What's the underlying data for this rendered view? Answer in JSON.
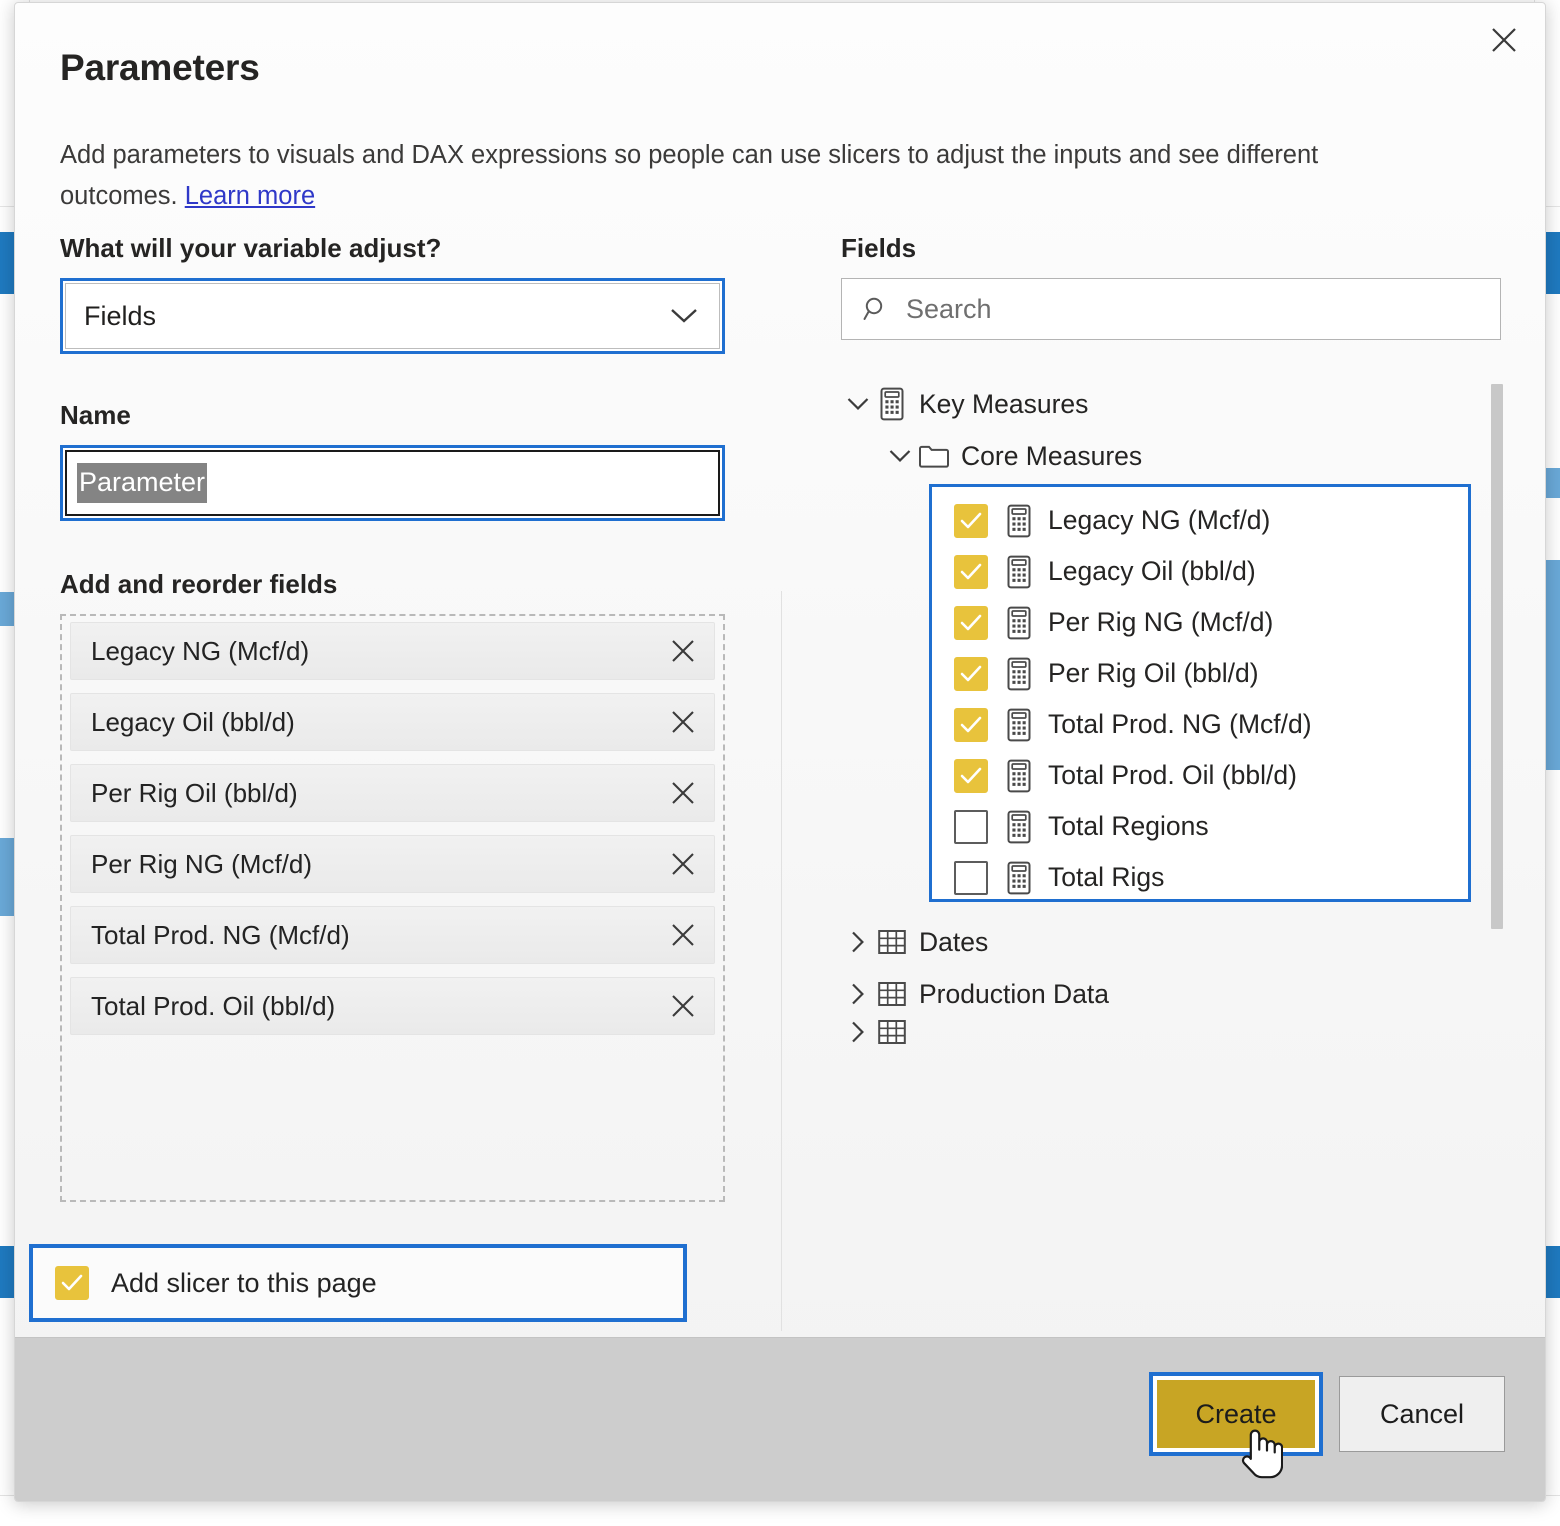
{
  "dialog": {
    "title": "Parameters",
    "description_part1": "Add parameters to visuals and DAX expressions so people can use slicers to adjust the inputs and see different outcomes. ",
    "learn_more": "Learn more",
    "close_icon": "close-icon"
  },
  "variable_type": {
    "label": "What will your variable adjust?",
    "selected": "Fields",
    "chevron_icon": "chevron-down-icon"
  },
  "name": {
    "label": "Name",
    "value": "Parameter",
    "selected": true
  },
  "reorder": {
    "label": "Add and reorder fields",
    "remove_icon": "close-icon",
    "items": [
      {
        "label": "Legacy NG (Mcf/d)"
      },
      {
        "label": "Legacy Oil (bbl/d)"
      },
      {
        "label": "Per Rig Oil (bbl/d)"
      },
      {
        "label": "Per Rig NG (Mcf/d)"
      },
      {
        "label": "Total Prod. NG (Mcf/d)"
      },
      {
        "label": "Total Prod. Oil (bbl/d)"
      }
    ]
  },
  "slicer": {
    "label": "Add slicer to this page",
    "checked": true
  },
  "fields_panel": {
    "label": "Fields",
    "search": {
      "placeholder": "Search",
      "value": "",
      "icon": "search-icon"
    },
    "tree": [
      {
        "label": "Key Measures",
        "icon": "measure-table-icon",
        "expanded": true,
        "indent": 0
      },
      {
        "label": "Core Measures",
        "icon": "folder-icon",
        "expanded": true,
        "indent": 1
      }
    ],
    "measures": [
      {
        "label": "Legacy NG (Mcf/d)",
        "checked": true,
        "icon": "calculator-icon"
      },
      {
        "label": "Legacy Oil (bbl/d)",
        "checked": true,
        "icon": "calculator-icon"
      },
      {
        "label": "Per Rig NG (Mcf/d)",
        "checked": true,
        "icon": "calculator-icon"
      },
      {
        "label": "Per Rig Oil (bbl/d)",
        "checked": true,
        "icon": "calculator-icon"
      },
      {
        "label": "Total Prod. NG (Mcf/d)",
        "checked": true,
        "icon": "calculator-icon"
      },
      {
        "label": "Total Prod. Oil (bbl/d)",
        "checked": true,
        "icon": "calculator-icon"
      },
      {
        "label": "Total Regions",
        "checked": false,
        "icon": "calculator-icon"
      },
      {
        "label": "Total Rigs",
        "checked": false,
        "icon": "calculator-icon"
      }
    ],
    "tables": [
      {
        "label": "Dates",
        "icon": "table-icon",
        "expanded": false
      },
      {
        "label": "Production Data",
        "icon": "table-icon",
        "expanded": false
      }
    ]
  },
  "footer": {
    "create_label": "Create",
    "cancel_label": "Cancel"
  },
  "colors": {
    "accent_focus": "#1F6FD0",
    "checkbox_gold": "#E8C33C",
    "primary_button": "#C8A524",
    "link": "#2F38C8",
    "background_chart_bar": "#1F7AC0"
  }
}
